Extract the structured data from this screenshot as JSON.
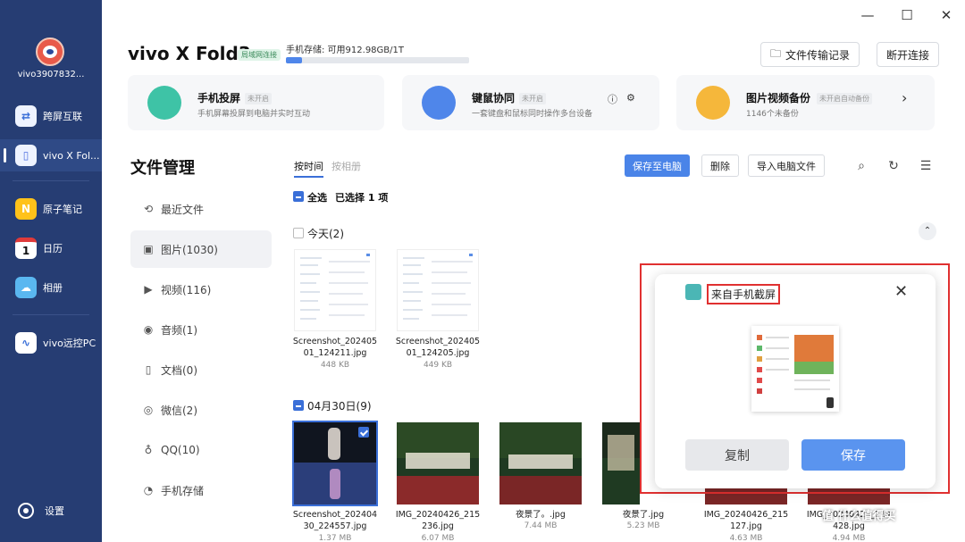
{
  "sidebar": {
    "account": "vivo3907832...",
    "items": [
      {
        "label": "跨屏互联",
        "icon": "cross-screen-icon",
        "color": "#f0f4ff"
      },
      {
        "label": "vivo X Fol...",
        "icon": "phone-icon",
        "color": "#6b8cff"
      },
      {
        "label": "原子笔记",
        "icon": "note-icon",
        "color": "#ffc21a"
      },
      {
        "label": "日历",
        "icon": "calendar-icon",
        "color": "#ffffff",
        "glyph": "1"
      },
      {
        "label": "相册",
        "icon": "album-icon",
        "color": "#5ab7f0"
      },
      {
        "label": "vivo远控PC",
        "icon": "remote-pc-icon",
        "color": "#ffffff"
      }
    ],
    "settings": "设置"
  },
  "window": {
    "minimize": "—",
    "maximize": "☐",
    "close": "✕"
  },
  "header": {
    "device_name": "vivo X Fold3",
    "lan_badge": "局域网连接",
    "storage_label": "手机存储: 可用912.98GB/1T",
    "storage_used_pct": 9,
    "transfer_button": "文件传输记录",
    "disconnect_button": "断开连接"
  },
  "cards": [
    {
      "title": "手机投屏",
      "badge": "未开启",
      "subtitle": "手机屏幕投屏到电脑并实时互动",
      "icon": "screen-cast-icon",
      "color": "#3ec3a6"
    },
    {
      "title": "键鼠协同",
      "badge": "未开启",
      "subtitle": "一套键盘和鼠标同时操作多台设备",
      "icon": "keyboard-icon",
      "color": "#4f86ea"
    },
    {
      "title": "图片视频备份",
      "badge": "未开启自动备份",
      "subtitle": "1146个未备份",
      "icon": "backup-icon",
      "color": "#f5b73b"
    }
  ],
  "file_manager": {
    "title": "文件管理",
    "nav": [
      {
        "label": "最近文件",
        "icon": "recent-icon",
        "glyph": "⟲"
      },
      {
        "label": "图片(1030)",
        "icon": "image-icon",
        "glyph": "▣"
      },
      {
        "label": "视频(116)",
        "icon": "video-icon",
        "glyph": "▶"
      },
      {
        "label": "音频(1)",
        "icon": "audio-icon",
        "glyph": "◉"
      },
      {
        "label": "文档(0)",
        "icon": "document-icon",
        "glyph": "▯"
      },
      {
        "label": "微信(2)",
        "icon": "wechat-icon",
        "glyph": "◎"
      },
      {
        "label": "QQ(10)",
        "icon": "qq-icon",
        "glyph": "♁"
      },
      {
        "label": "手机存储",
        "icon": "phone-storage-icon",
        "glyph": "◔"
      }
    ]
  },
  "toolbar": {
    "tab_time": "按时间",
    "tab_album": "按相册",
    "save_to_pc": "保存至电脑",
    "delete": "删除",
    "import": "导入电脑文件"
  },
  "selection": {
    "select_all": "全选",
    "selected": "已选择 1 项"
  },
  "groups": [
    {
      "title": "今天(2)",
      "files": [
        {
          "name": "Screenshot_202405\n01_124211.jpg",
          "size": "448 KB"
        },
        {
          "name": "Screenshot_202405\n01_124205.jpg",
          "size": "449 KB"
        }
      ]
    },
    {
      "title": "04月30日(9)",
      "files": [
        {
          "name": "Screenshot_202404\n30_224557.jpg",
          "size": "1.37 MB"
        },
        {
          "name": "IMG_20240426_215\n236.jpg",
          "size": "6.07 MB"
        },
        {
          "name": "夜景了。.jpg",
          "size": "7.44 MB"
        },
        {
          "name": "夜景了.jpg",
          "size": "5.23 MB"
        },
        {
          "name": "IMG_20240426_215\n127.jpg",
          "size": "4.63 MB"
        },
        {
          "name": "IMG_20240426_214\n428.jpg",
          "size": "4.94 MB"
        }
      ]
    }
  ],
  "popup": {
    "title": "来自手机截屏",
    "copy": "复制",
    "save": "保存"
  },
  "watermark": "值 什么值得买"
}
